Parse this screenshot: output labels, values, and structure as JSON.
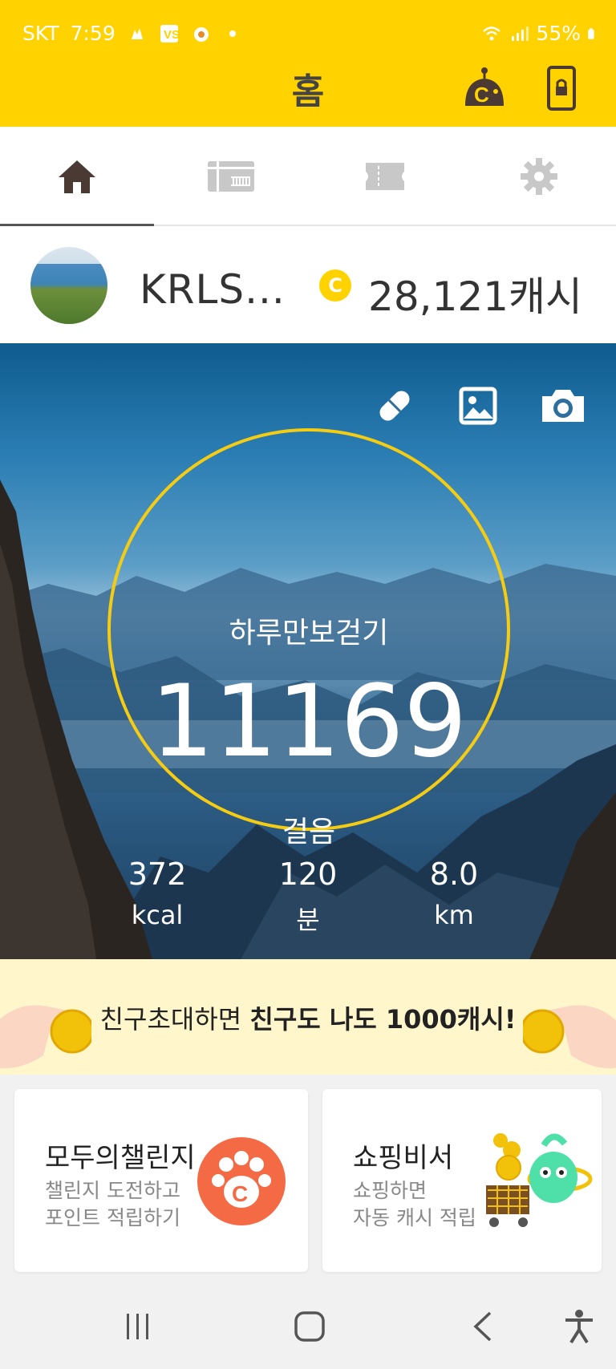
{
  "status_bar": {
    "carrier": "SKT",
    "time": "7:59",
    "battery": "55%"
  },
  "app_bar": {
    "title": "홈"
  },
  "tabs": [
    {
      "name": "home",
      "icon": "home-icon",
      "active": true
    },
    {
      "name": "gift",
      "icon": "gift-card-icon",
      "active": false
    },
    {
      "name": "ticket",
      "icon": "ticket-icon",
      "active": false
    },
    {
      "name": "settings",
      "icon": "gear-icon",
      "active": false
    }
  ],
  "profile": {
    "username": "KRLS...",
    "cash": "28,121캐시",
    "coin_letter": "C"
  },
  "pedometer": {
    "label": "하루만보걷기",
    "steps": "11169",
    "steps_unit": "걸음",
    "stats": [
      {
        "value": "372",
        "unit": "kcal"
      },
      {
        "value": "120",
        "unit": "분"
      },
      {
        "value": "8.0",
        "unit": "km"
      }
    ],
    "ring_color": "#f5cc14"
  },
  "banner": {
    "text_plain": "친구초대하면 ",
    "text_bold": "친구도 나도 1000캐시!"
  },
  "cards": [
    {
      "title": "모두의챌린지",
      "sub1": "챌린지 도전하고",
      "sub2": "포인트 적립하기",
      "paw_letter": "C"
    },
    {
      "title": "쇼핑비서",
      "sub1": "쇼핑하면",
      "sub2": "자동 캐시 적립"
    }
  ],
  "colors": {
    "brand_yellow": "#ffd200",
    "title_text": "#444444",
    "paw_orange": "#f36a45"
  }
}
